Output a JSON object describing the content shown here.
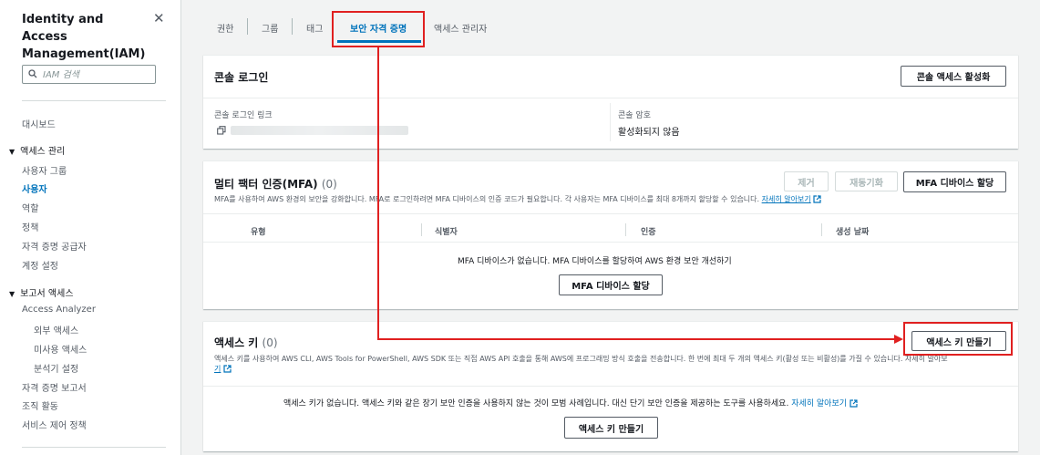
{
  "sidebar": {
    "title": "Identity and Access Management(IAM)",
    "search_placeholder": "IAM 검색",
    "dashboard": "대시보드",
    "access_mgmt": {
      "heading": "액세스 관리",
      "items": [
        "사용자 그룹",
        "사용자",
        "역할",
        "정책",
        "자격 증명 공급자",
        "계정 설정"
      ]
    },
    "reports": {
      "heading": "보고서 액세스",
      "analyzer": "Access Analyzer",
      "analyzer_items": [
        "외부 액세스",
        "미사용 액세스",
        "분석기 설정"
      ],
      "items": [
        "자격 증명 보고서",
        "조직 활동",
        "서비스 제어 정책"
      ]
    }
  },
  "tabs": [
    "권한",
    "그룹",
    "태그",
    "보안 자격 증명",
    "액세스 관리자"
  ],
  "console": {
    "title": "콘솔 로그인",
    "enable_button": "콘솔 액세스 활성화",
    "link_label": "콘솔 로그인 링크",
    "password_label": "콘솔 암호",
    "password_value": "활성화되지 않음"
  },
  "mfa": {
    "title": "멀티 팩터 인증(MFA)",
    "count": "(0)",
    "remove_button": "제거",
    "resync_button": "재동기화",
    "assign_button": "MFA 디바이스 할당",
    "description": "MFA를 사용하여 AWS 환경의 보안을 강화합니다. MFA로 로그인하려면 MFA 디바이스의 인증 코드가 필요합니다. 각 사용자는 MFA 디바이스를 최대 8개까지 할당할 수 있습니다.",
    "learn_more": "자세히 알아보기",
    "columns": [
      "유형",
      "식별자",
      "인증",
      "생성 날짜"
    ],
    "empty_text": "MFA 디바이스가 없습니다. MFA 디바이스를 할당하여 AWS 환경 보안 개선하기",
    "empty_button": "MFA 디바이스 할당"
  },
  "access_keys": {
    "title": "액세스 키",
    "count": "(0)",
    "create_button": "액세스 키 만들기",
    "description": "액세스 키를 사용하여 AWS CLI, AWS Tools for PowerShell, AWS SDK 또는 직접 AWS API 호출을 통해 AWS에 프로그래밍 방식 호출을 전송합니다. 한 번에 최대 두 개의 액세스 키(활성 또는 비활성)를 가질 수 있습니다. 자세히 알아보",
    "description_tail": "기",
    "empty_text": "액세스 키가 없습니다. 액세스 키와 같은 장기 보안 인증을 사용하지 않는 것이 모범 사례입니다. 대신 단기 보안 인증을 제공하는 도구를 사용하세요.",
    "learn_more": "자세히 알아보기",
    "empty_button": "액세스 키 만들기"
  },
  "colors": {
    "accent": "#0073bb",
    "highlight": "#e02020"
  },
  "icons": [
    "close-icon",
    "search-icon",
    "copy-icon",
    "external-link-icon",
    "caret-down-icon"
  ]
}
